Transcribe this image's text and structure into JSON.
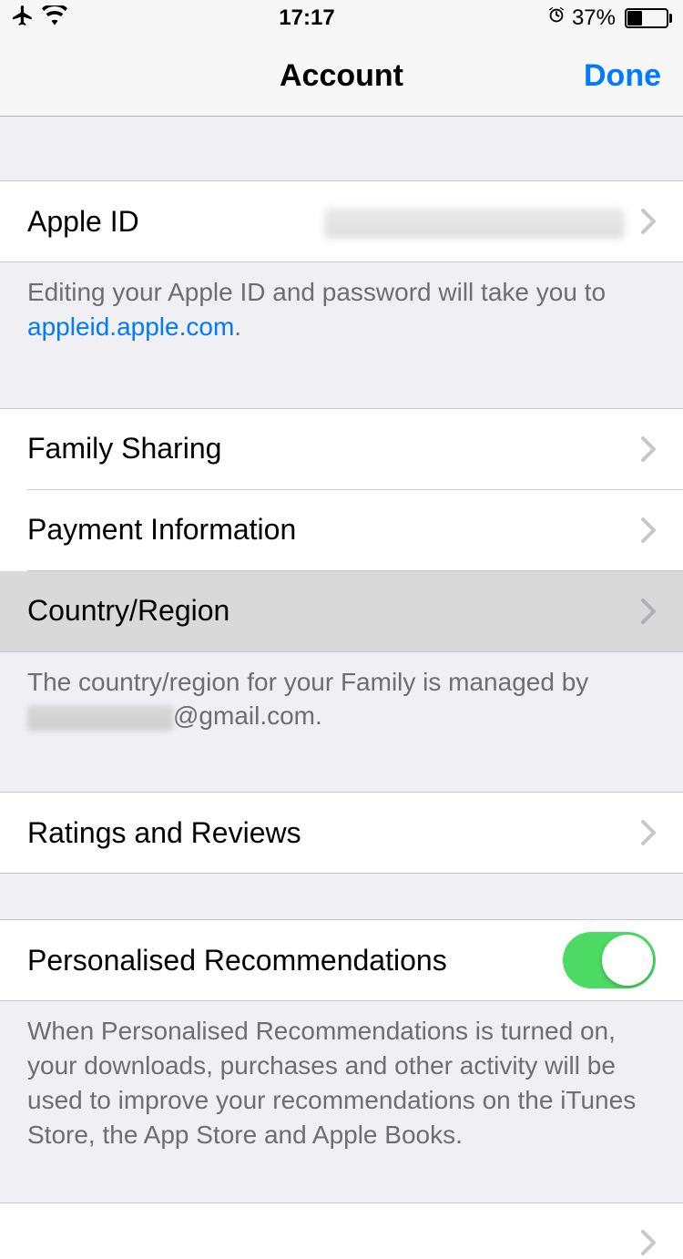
{
  "statusBar": {
    "time": "17:17",
    "batteryPercent": "37%"
  },
  "nav": {
    "title": "Account",
    "done": "Done"
  },
  "rows": {
    "appleId": {
      "label": "Apple ID"
    },
    "familySharing": {
      "label": "Family Sharing"
    },
    "paymentInfo": {
      "label": "Payment Information"
    },
    "countryRegion": {
      "label": "Country/Region"
    },
    "ratingsReviews": {
      "label": "Ratings and Reviews"
    },
    "personalisedRecs": {
      "label": "Personalised Recommendations",
      "enabled": true
    }
  },
  "footers": {
    "appleIdNote1": "Editing your Apple ID and password will take you to ",
    "appleIdLink": "appleid.apple.com",
    "appleIdNote2": ".",
    "countryNote1": "The country/region for your Family is managed by ",
    "countryNote2": "@gmail.com.",
    "recsNote": "When Personalised Recommendations is turned on, your downloads, purchases and other activity will be used to improve your recommendations on the iTunes Store, the App Store and Apple Books."
  }
}
